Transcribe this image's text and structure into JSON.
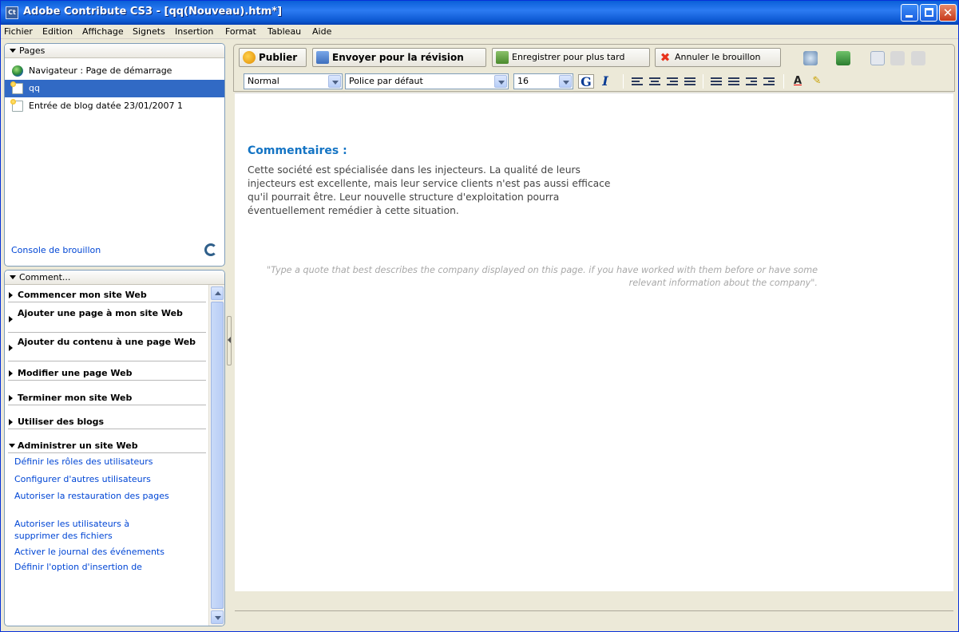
{
  "window": {
    "app_icon_text": "Ct",
    "title": "Adobe Contribute CS3 - [qq(Nouveau).htm*]"
  },
  "menu": [
    "Fichier",
    "Edition",
    "Affichage",
    "Signets",
    "Insertion",
    "Format",
    "Tableau",
    "Aide"
  ],
  "pages_panel": {
    "header": "Pages",
    "items": [
      {
        "label": "Navigateur : Page de démarrage",
        "icon": "globe-icon",
        "selected": false
      },
      {
        "label": "qq",
        "icon": "new-page-icon",
        "selected": true
      },
      {
        "label": "Entrée de blog datée 23/01/2007 1",
        "icon": "new-page-icon",
        "selected": false
      }
    ],
    "console_link": "Console de brouillon"
  },
  "comment_panel": {
    "header": "Comment...",
    "sections": [
      {
        "label": "Commencer mon site Web",
        "expanded": false
      },
      {
        "label": "Ajouter une page à mon site Web",
        "expanded": false
      },
      {
        "label": "Ajouter du contenu à une page Web",
        "expanded": false
      },
      {
        "label": "Modifier une page Web",
        "expanded": false
      },
      {
        "label": "Terminer mon site Web",
        "expanded": false
      },
      {
        "label": "Utiliser des blogs",
        "expanded": false
      },
      {
        "label": "Administrer un site Web",
        "expanded": true
      }
    ],
    "links": [
      "Définir les rôles des utilisateurs",
      "Configurer d'autres utilisateurs",
      "Autoriser la restauration des pages",
      "Autoriser les utilisateurs à supprimer des fichiers",
      "Activer le journal des événements",
      "Définir l'option d'insertion de"
    ]
  },
  "toolbar": {
    "publish": "Publier",
    "review": "Envoyer pour la révision",
    "save_later": "Enregistrer pour plus tard",
    "cancel_draft": "Annuler le brouillon"
  },
  "format_bar": {
    "style": "Normal",
    "font": "Police par défaut",
    "size": "16",
    "bold_label": "G",
    "italic_label": "I",
    "text_color_label": "A"
  },
  "document": {
    "heading": "Commentaires :",
    "body": "Cette société est spécialisée dans les injecteurs. La qualité de leurs injecteurs est excellente, mais leur service clients n'est pas aussi efficace qu'il pourrait être. Leur nouvelle structure d'exploitation pourra éventuellement remédier à cette situation.",
    "quote": "\"Type a quote that best describes the company displayed on this page. if you have worked with them before or have some relevant information about the company\"."
  },
  "colors": {
    "title_bar": "#0a5fd8",
    "selection": "#316ac5",
    "heading": "#1474c4",
    "link": "#0046d5"
  }
}
